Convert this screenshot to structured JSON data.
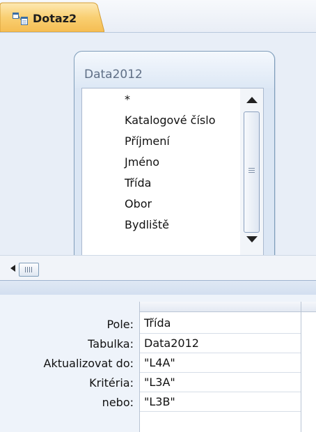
{
  "document": {
    "tab_title": "Dotaz2",
    "tab_icon": "query-design-icon"
  },
  "table": {
    "title": "Data2012",
    "fields": [
      "*",
      "Katalogové číslo",
      "Příjmení",
      "Jméno",
      "Třída",
      "Obor",
      "Bydliště"
    ]
  },
  "grid": {
    "row_labels": {
      "field": "Pole:",
      "table": "Tabulka:",
      "update_to": "Aktualizovat do:",
      "criteria": "Kritéria:",
      "or": "nebo:"
    },
    "column1": {
      "field": "Třída",
      "table": "Data2012",
      "update_to": "\"L4A\"",
      "criteria": "\"L3A\"",
      "or": "\"L3B\""
    }
  },
  "colors": {
    "tab_active": "#f7c76a",
    "pane_background": "#e8eef7",
    "border": "#7f9db9"
  }
}
